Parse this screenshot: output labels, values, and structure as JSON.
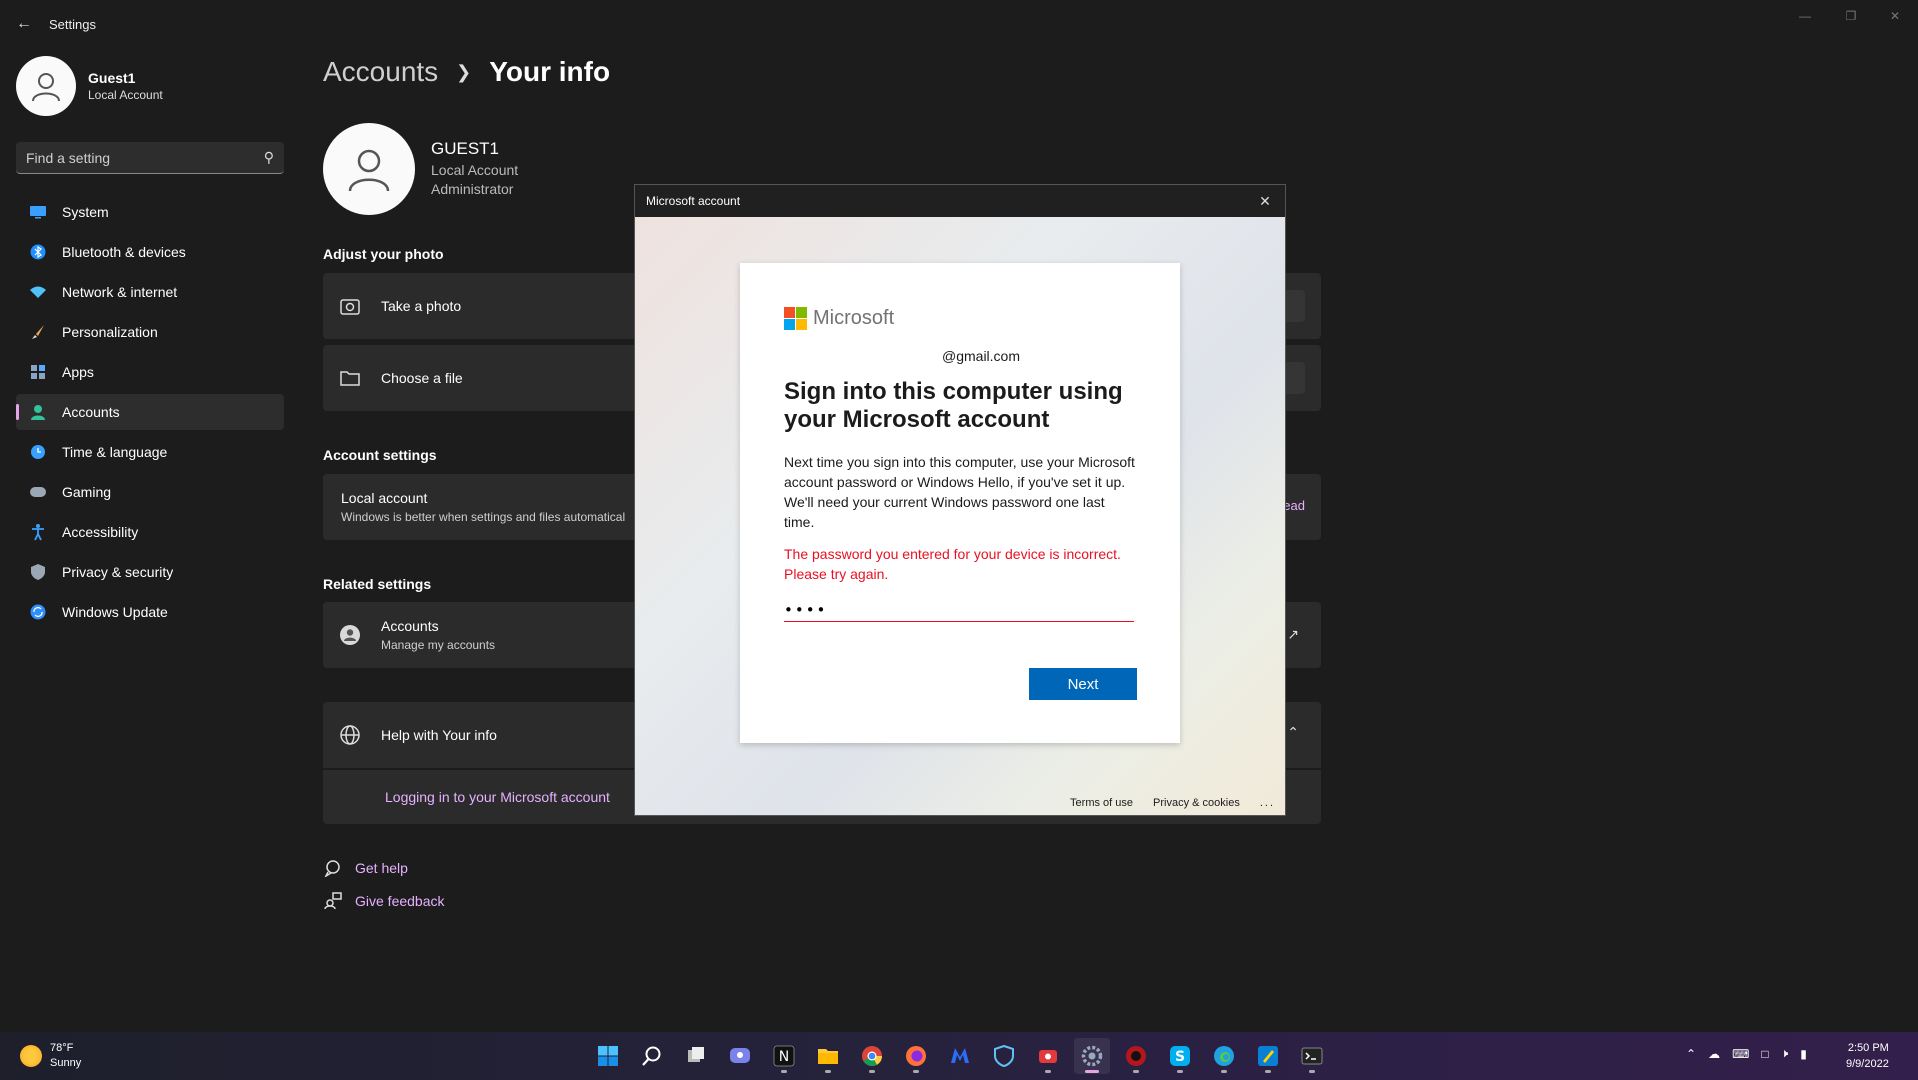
{
  "window": {
    "title": "Settings"
  },
  "profile": {
    "name": "Guest1",
    "type": "Local Account"
  },
  "search": {
    "placeholder": "Find a setting"
  },
  "nav": [
    {
      "label": "System",
      "icon": "monitor-icon",
      "color": "#3aa0ff"
    },
    {
      "label": "Bluetooth & devices",
      "icon": "bluetooth-icon",
      "color": "#1e90ff"
    },
    {
      "label": "Network & internet",
      "icon": "wifi-icon",
      "color": "#4fc3f7"
    },
    {
      "label": "Personalization",
      "icon": "brush-icon",
      "color": "#f0a35e"
    },
    {
      "label": "Apps",
      "icon": "apps-icon",
      "color": "#8aa4c8"
    },
    {
      "label": "Accounts",
      "icon": "person-icon",
      "color": "#2fc29c"
    },
    {
      "label": "Time & language",
      "icon": "globe-clock-icon",
      "color": "#3aa0ff"
    },
    {
      "label": "Gaming",
      "icon": "gamepad-icon",
      "color": "#9aa7b5"
    },
    {
      "label": "Accessibility",
      "icon": "accessibility-icon",
      "color": "#3aa0ff"
    },
    {
      "label": "Privacy & security",
      "icon": "shield-icon",
      "color": "#9aa7b5"
    },
    {
      "label": "Windows Update",
      "icon": "update-icon",
      "color": "#2f8fff"
    }
  ],
  "active_nav": "Accounts",
  "breadcrumb": {
    "parent": "Accounts",
    "current": "Your info"
  },
  "user": {
    "name": "GUEST1",
    "account_type": "Local Account",
    "role": "Administrator"
  },
  "sections": {
    "adjust_photo": "Adjust your photo",
    "account_settings": "Account settings",
    "related_settings": "Related settings"
  },
  "photo_options": {
    "take_photo": "Take a photo",
    "choose_file": "Choose a file"
  },
  "local_account": {
    "title": "Local account",
    "subtitle": "Windows is better when settings and files automatical",
    "action_fragment": "ead"
  },
  "related": {
    "title": "Accounts",
    "subtitle": "Manage my accounts"
  },
  "help": {
    "title": "Help with Your info",
    "link": "Logging in to your Microsoft account"
  },
  "footer_links": {
    "get_help": "Get help",
    "feedback": "Give feedback"
  },
  "dialog": {
    "title": "Microsoft account",
    "brand": "Microsoft",
    "email": "@gmail.com",
    "heading": "Sign into this computer using your Microsoft account",
    "description": "Next time you sign into this computer, use your Microsoft account password or Windows Hello, if you've set it up.",
    "description2": "We'll need your current Windows password one last time.",
    "error": "The password you entered for your device is incorrect. Please try again.",
    "password_value": "••••",
    "next_label": "Next",
    "terms": "Terms of use",
    "privacy": "Privacy & cookies",
    "more": "..."
  },
  "taskbar": {
    "weather_temp": "78°F",
    "weather_cond": "Sunny",
    "time": "2:50 PM",
    "date": "9/9/2022",
    "apps": [
      "start-icon",
      "search-icon",
      "task-view-icon",
      "chat-icon",
      "notion-icon",
      "file-explorer-icon",
      "chrome-icon",
      "firefox-icon",
      "malwarebytes-icon",
      "defender-icon",
      "recorder-icon",
      "settings-icon",
      "app-icon",
      "skype-icon",
      "edge-icon",
      "paint-icon",
      "terminal-icon"
    ],
    "active_app": "settings-icon"
  },
  "colors": {
    "accent": "#e7a5e9",
    "ms_blue": "#0067b8",
    "error": "#e81123"
  }
}
